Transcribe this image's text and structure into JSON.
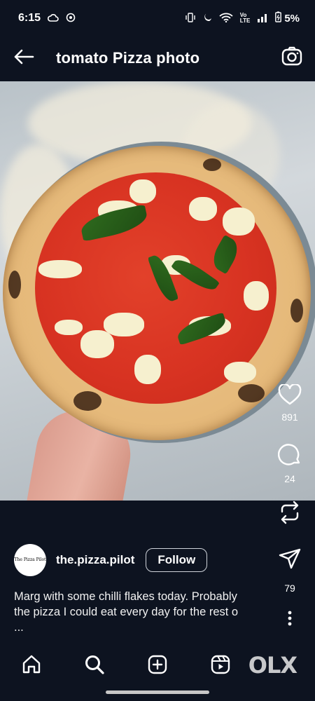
{
  "status_bar": {
    "time": "6:15",
    "battery": "5%",
    "icons": [
      "cloud-icon",
      "sync-icon",
      "vibrate-icon",
      "moon-icon",
      "wifi-icon",
      "volte-icon",
      "signal-icon",
      "battery-icon"
    ]
  },
  "header": {
    "title": "tomato Pizza photo",
    "back_icon": "arrow-left-icon",
    "camera_icon": "camera-icon"
  },
  "post": {
    "likes": "891",
    "comments": "24",
    "shares": "79",
    "author": {
      "username": "the.pizza.pilot",
      "avatar_text": "The Pizza Pilot"
    },
    "follow_label": "Follow",
    "caption_lines": [
      "Marg with some chilli flakes today. Probably",
      "the pizza I could eat every day for the rest o",
      "..."
    ]
  },
  "bottom_nav": {
    "items": [
      "home-icon",
      "search-icon",
      "create-icon",
      "reels-icon"
    ],
    "watermark": "OLX"
  },
  "colors": {
    "background": "#0d1320",
    "text": "#ffffff",
    "button_border": "#cfd3da"
  }
}
